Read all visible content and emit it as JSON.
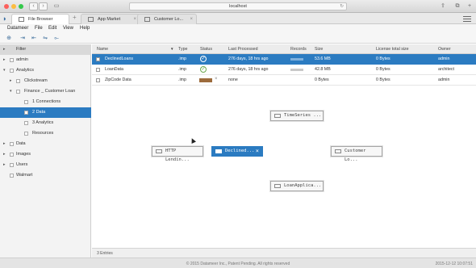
{
  "browser": {
    "url": "localhost"
  },
  "app_tabs": [
    {
      "label": "File Browser",
      "active": true
    },
    {
      "label": "App Market",
      "active": false
    },
    {
      "label": "Customer Lo...",
      "active": false
    }
  ],
  "menu": [
    "Datameer",
    "File",
    "Edit",
    "View",
    "Help"
  ],
  "sidebar": {
    "items": [
      {
        "label": "Filter",
        "twisty": "▸",
        "level": 0,
        "type": "header"
      },
      {
        "label": "admin",
        "twisty": "▸",
        "level": 0
      },
      {
        "label": "Analytics",
        "twisty": "▾",
        "level": 0
      },
      {
        "label": "Clickstream",
        "twisty": "▸",
        "level": 1
      },
      {
        "label": "Finance _ Customer Loan",
        "twisty": "▾",
        "level": 1
      },
      {
        "label": "1 Connections",
        "twisty": "",
        "level": 2
      },
      {
        "label": "2 Data",
        "twisty": "",
        "level": 2,
        "selected": true
      },
      {
        "label": "3 Analytics",
        "twisty": "",
        "level": 2
      },
      {
        "label": "Resources",
        "twisty": "",
        "level": 2
      },
      {
        "label": "Data",
        "twisty": "▸",
        "level": 0
      },
      {
        "label": "Images",
        "twisty": "▸",
        "level": 0
      },
      {
        "label": "Users",
        "twisty": "▸",
        "level": 0
      },
      {
        "label": "Walmart",
        "twisty": "",
        "level": 0
      }
    ]
  },
  "table": {
    "columns": [
      "Name",
      "Type",
      "Status",
      "Last Processed",
      "Records",
      "Size",
      "License total size",
      "Owner"
    ],
    "rows": [
      {
        "name": "DeclinedLoans",
        "type": ".imp",
        "status": "ok",
        "last_processed": "276 days, 18 hrs ago",
        "size": "53.6 MB",
        "license": "0 Bytes",
        "owner": "admin",
        "selected": true
      },
      {
        "name": "LoanData",
        "type": ".imp",
        "status": "ok",
        "last_processed": "276 days, 18 hrs ago",
        "size": "42.8 MB",
        "license": "0 Bytes",
        "owner": "architect"
      },
      {
        "name": "ZipCode Data",
        "type": ".imp",
        "status": "pending",
        "last_processed": "none",
        "size": "0 Bytes",
        "license": "0 Bytes",
        "owner": "admin"
      }
    ]
  },
  "graph": {
    "nodes": {
      "http": "HTTP Lendin...",
      "declined": "Declined...",
      "timeseries": "TimeSeries ...",
      "customer": "Customer Lo...",
      "loanapp": "LoanApplica..."
    }
  },
  "status": {
    "entries": "3 Entries"
  },
  "footer": {
    "copyright": "© 2015 Datameer Inc., Patent Pending. All rights reserved",
    "timestamp": "2015-12-12 10:07:51"
  },
  "colors": {
    "accent": "#2b7bc1",
    "status_ok": "#6aa84f",
    "status_pending": "#9c6b3c"
  }
}
